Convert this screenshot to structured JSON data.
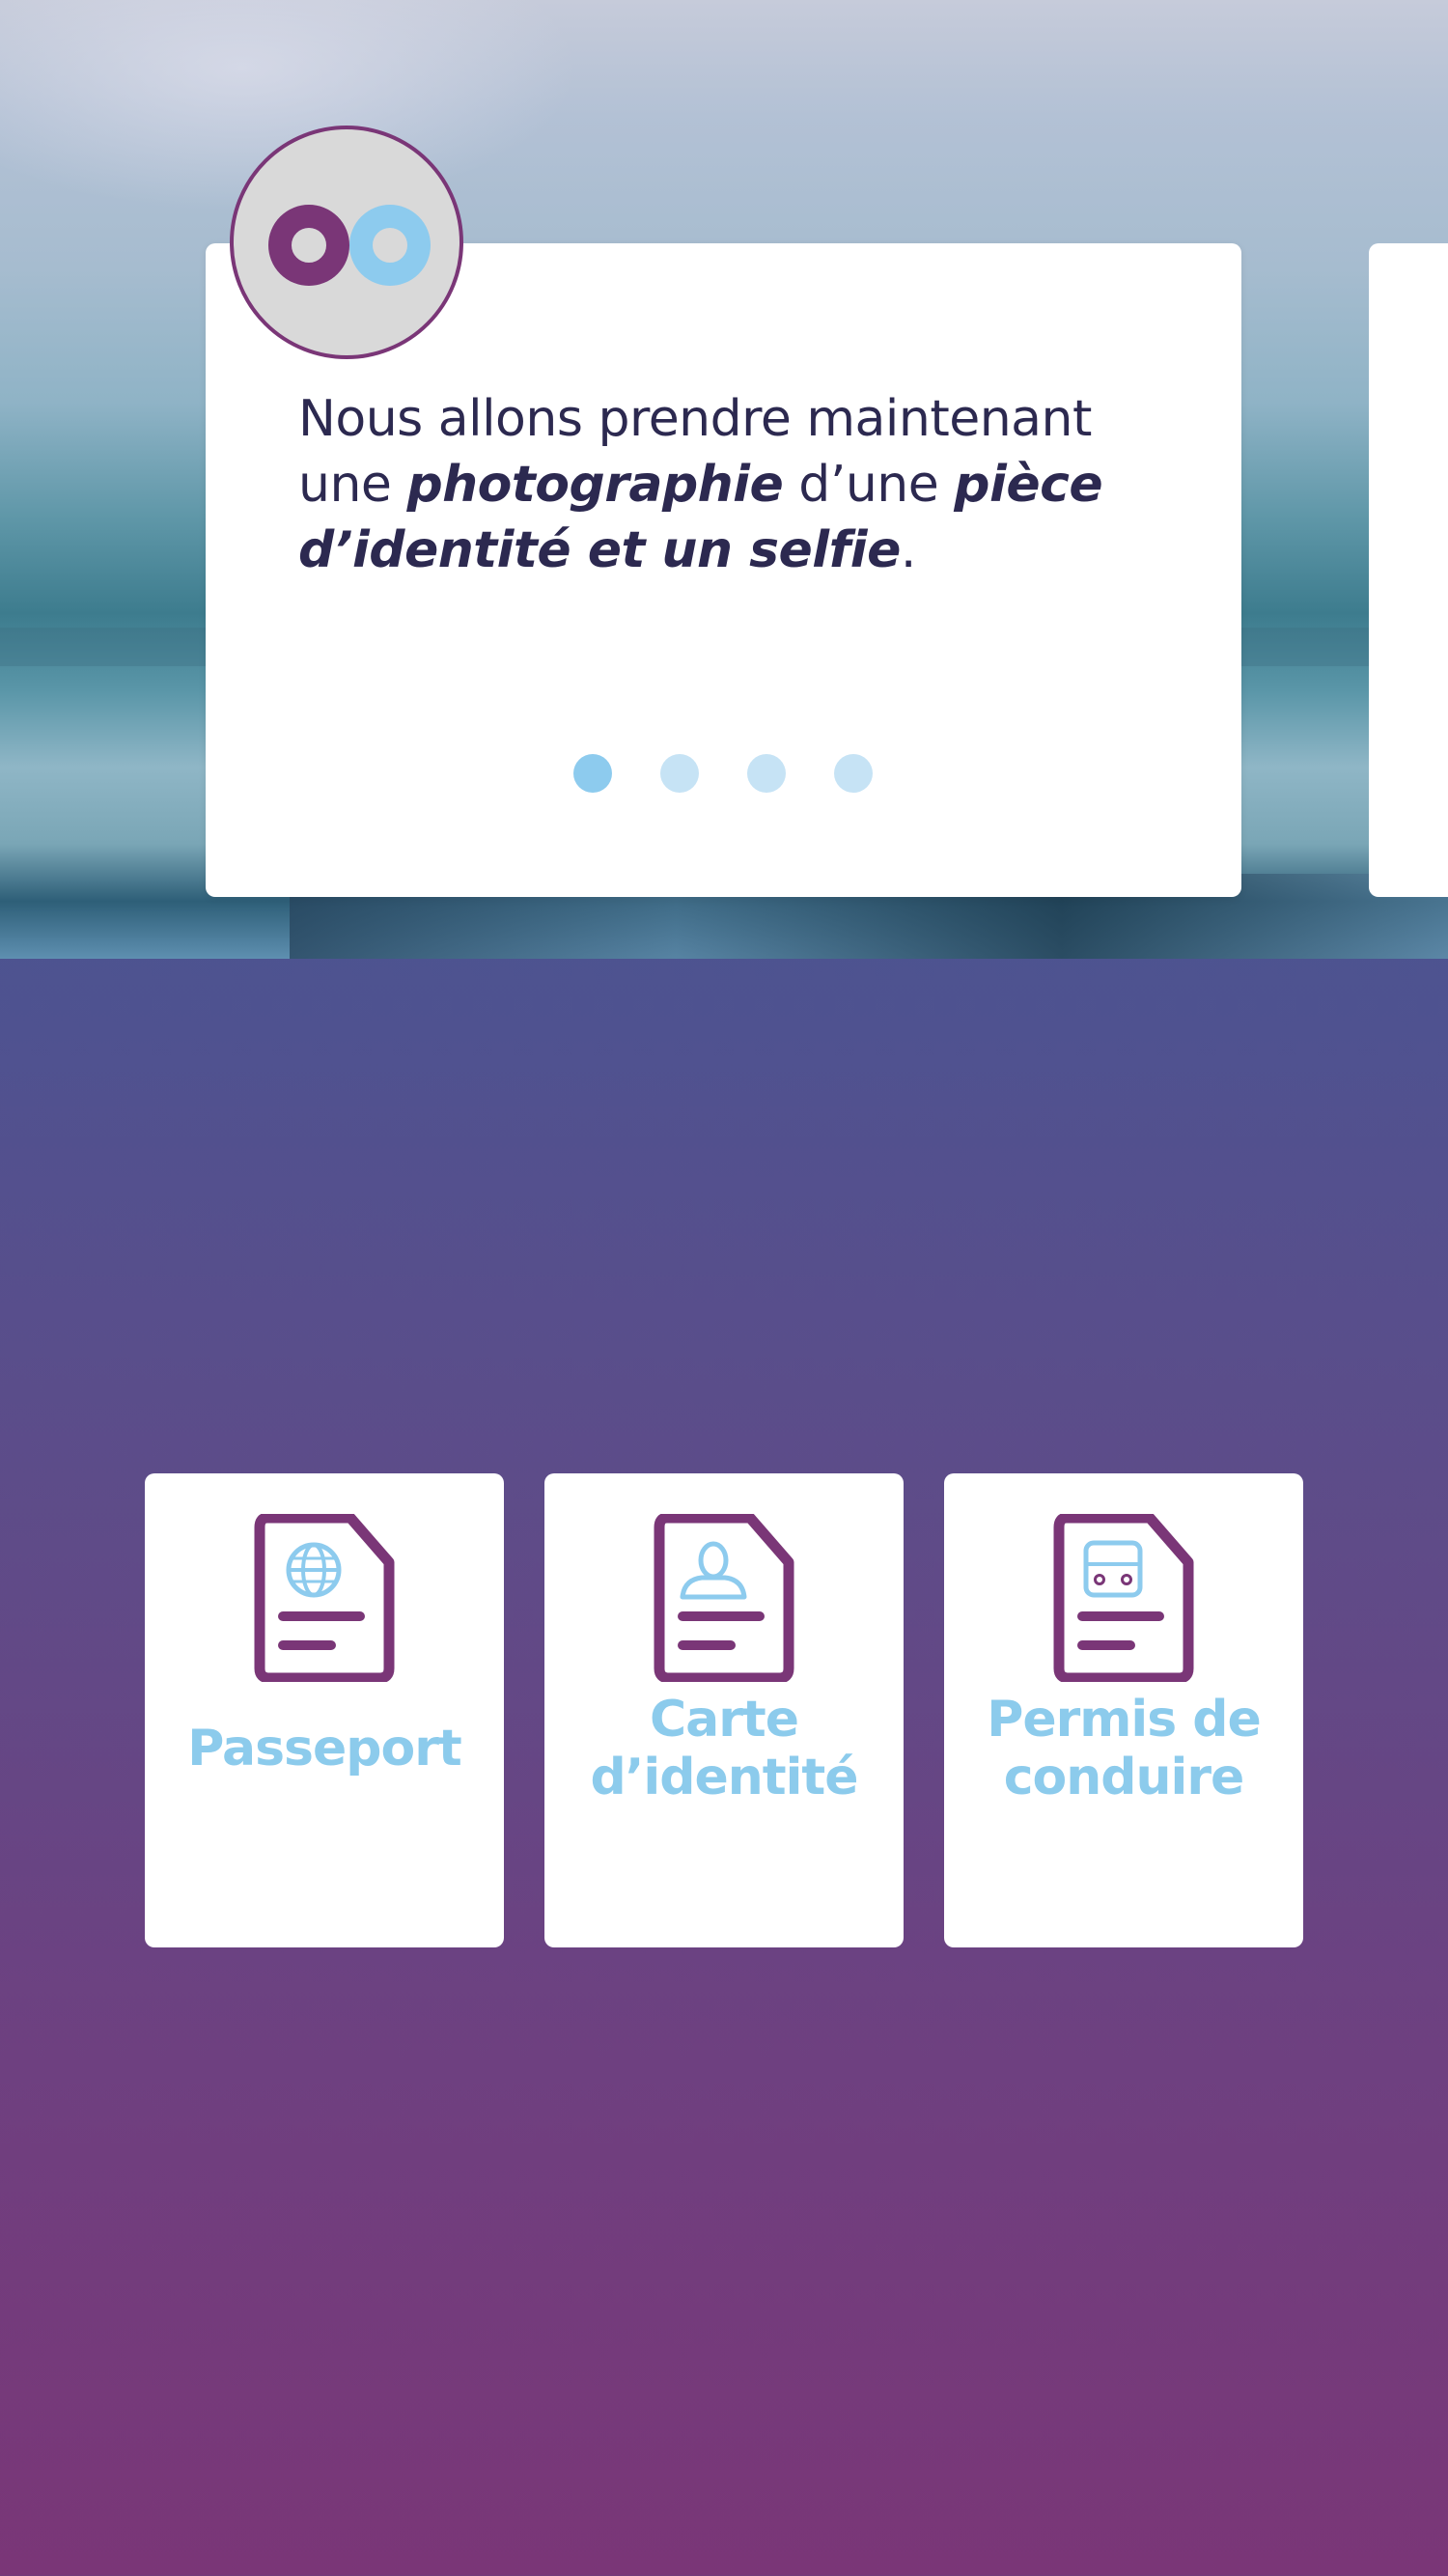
{
  "onboarding": {
    "text_part1": "Nous allons prendre maintenant une ",
    "text_bold1": "photographie",
    "text_part2": " d’une ",
    "text_bold2": "pièce d’identité et un selfie",
    "text_part3": ".",
    "pagination": {
      "total": 4,
      "current": 1
    }
  },
  "logo": {
    "letters": "OO",
    "color_left": "#7a3677",
    "color_right": "#8dcbee"
  },
  "documents": [
    {
      "label": "Passeport",
      "icon": "passport-globe-icon"
    },
    {
      "label_line1": "Carte",
      "label_line2": "d’identité",
      "icon": "id-card-person-icon"
    },
    {
      "label_line1": "Permis de",
      "label_line2": "conduire",
      "icon": "driving-license-car-icon"
    }
  ],
  "colors": {
    "primary_purple": "#7a3677",
    "accent_blue": "#8dcbee",
    "text_dark": "#2c2950",
    "dot_inactive": "#c6e3f5",
    "gradient_top": "#3d5d95",
    "gradient_bottom": "#7a3677"
  }
}
